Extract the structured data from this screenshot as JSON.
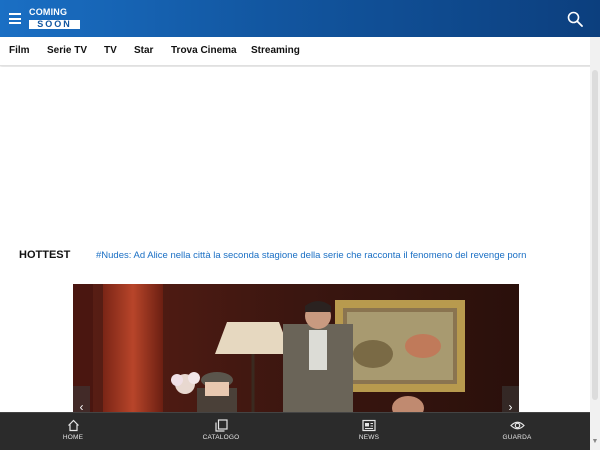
{
  "header": {
    "logo_top": "COMING",
    "logo_bottom": "SOON",
    "accent_color": "#1a6fc4"
  },
  "nav": {
    "items": [
      "Film",
      "Serie TV",
      "TV",
      "Star",
      "Trova Cinema",
      "Streaming"
    ]
  },
  "hottest": {
    "label": "HOTTEST",
    "headline": "#Nudes: Ad Alice nella città la seconda stagione della serie che racconta il fenomeno del revenge porn"
  },
  "carousel": {
    "prev_icon": "chevron-left-icon",
    "next_icon": "chevron-right-icon"
  },
  "bottom_nav": {
    "items": [
      {
        "label": "HOME",
        "icon": "home-icon"
      },
      {
        "label": "CATALOGO",
        "icon": "catalog-icon"
      },
      {
        "label": "NEWS",
        "icon": "news-icon"
      },
      {
        "label": "GUARDA",
        "icon": "eye-icon"
      }
    ]
  }
}
